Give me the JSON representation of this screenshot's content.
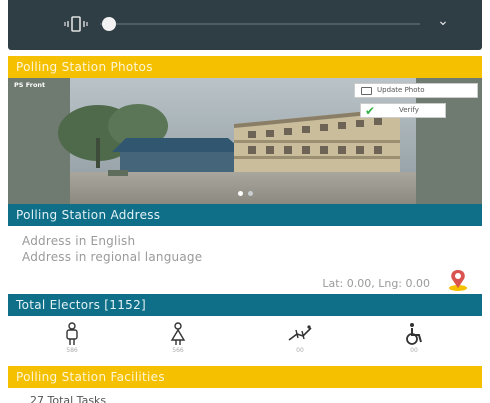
{
  "media_bar": {
    "icons": [
      "vibrate-icon",
      "chevron-down-icon"
    ]
  },
  "photos_section": {
    "title": "Polling Station Photos",
    "photo_label": "PS Front",
    "update_photo_label": "Update Photo",
    "verify_label": "Verify"
  },
  "address_section": {
    "title": "Polling Station Address",
    "address_english": "Address in English",
    "address_regional": "Address in regional language",
    "latlng": "Lat: 0.00, Lng: 0.00"
  },
  "electors_section": {
    "title": "Total Electors [1152]",
    "items": [
      {
        "icon": "male-voter-icon",
        "count": "586"
      },
      {
        "icon": "female-voter-icon",
        "count": "566"
      },
      {
        "icon": "third-gender-icon",
        "count": "00"
      },
      {
        "icon": "pwd-wheelchair-icon",
        "count": "00"
      }
    ]
  },
  "facilities_section": {
    "title": "Polling Station Facilities",
    "tasks_label": "27 Total Tasks"
  },
  "colors": {
    "header_dark": "#2f3e45",
    "yellow": "#f5c000",
    "teal": "#0f6f88",
    "accent_orange": "#f08a24",
    "icon_red": "#d9534f"
  }
}
